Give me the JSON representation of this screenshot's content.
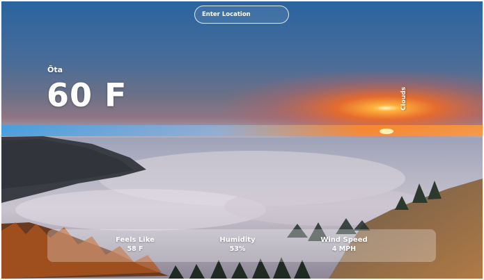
{
  "search": {
    "placeholder": "Enter Location",
    "value": ""
  },
  "weather": {
    "location": "Ōta",
    "temperature": "60 F",
    "description": "Clouds"
  },
  "stats": {
    "feels_like": {
      "label": "Feels Like",
      "value": "58 F"
    },
    "humidity": {
      "label": "Humidity",
      "value": "53%"
    },
    "wind_speed": {
      "label": "Wind Speed",
      "value": "4 MPH"
    }
  },
  "background": {
    "subject": "sunset above sea of clouds",
    "colors": {
      "sky_top": "#2f6ea6",
      "sky_mid": "#5b6f8f",
      "sunset": "#f07a2a",
      "cloud": "#b6b3c2",
      "forest": "#3b3a3f"
    }
  }
}
